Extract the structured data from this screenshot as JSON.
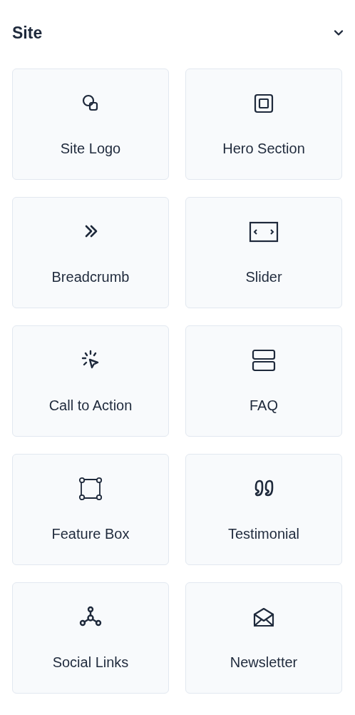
{
  "section": {
    "title": "Site",
    "expanded": true
  },
  "items": [
    {
      "label": "Site Logo",
      "kind": "logo"
    },
    {
      "label": "Hero Section",
      "kind": "hero"
    },
    {
      "label": "Breadcrumb",
      "kind": "breadcrumb"
    },
    {
      "label": "Slider",
      "kind": "slider"
    },
    {
      "label": "Call to Action",
      "kind": "cta"
    },
    {
      "label": "FAQ",
      "kind": "faq"
    },
    {
      "label": "Feature Box",
      "kind": "feature"
    },
    {
      "label": "Testimonial",
      "kind": "testimonial"
    },
    {
      "label": "Social Links",
      "kind": "social"
    },
    {
      "label": "Newsletter",
      "kind": "newsletter"
    }
  ]
}
